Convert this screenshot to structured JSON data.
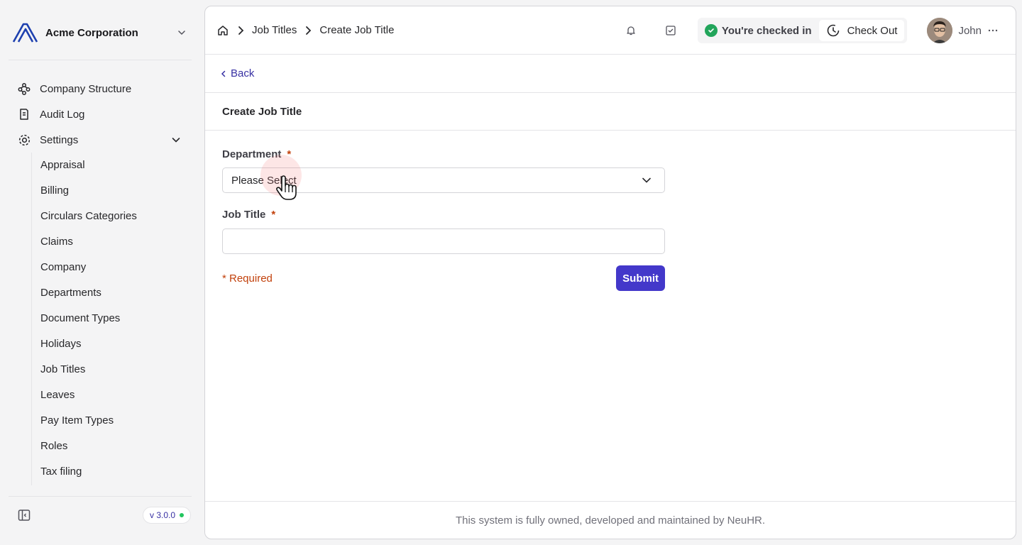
{
  "org": {
    "name": "Acme Corporation",
    "logo_icon": "acme-logo",
    "brand_color": "#1e40af"
  },
  "sidebar": {
    "items": [
      {
        "label": "Company Structure",
        "icon": "org-chart-icon"
      },
      {
        "label": "Audit Log",
        "icon": "document-icon"
      },
      {
        "label": "Settings",
        "icon": "gear-icon",
        "expanded": true
      }
    ],
    "settings_items": [
      "Appraisal",
      "Billing",
      "Circulars Categories",
      "Claims",
      "Company",
      "Departments",
      "Document Types",
      "Holidays",
      "Job Titles",
      "Leaves",
      "Pay Item Types",
      "Roles",
      "Tax filing"
    ],
    "version": "v 3.0.0"
  },
  "header": {
    "breadcrumbs": [
      "Job Titles",
      "Create Job Title"
    ],
    "checkin_status": "You're checked in",
    "checkout_label": "Check Out",
    "user_name": "John"
  },
  "page": {
    "back_label": "Back",
    "title": "Create Job Title"
  },
  "form": {
    "department_label": "Department",
    "department_value": "Please Select",
    "job_title_label": "Job Title",
    "job_title_value": "",
    "required_star": "*",
    "required_note": "* Required",
    "submit_label": "Submit"
  },
  "footer": {
    "text": "This system is fully owned, developed and maintained by NeuHR."
  },
  "colors": {
    "accent": "#4338ca",
    "link": "#3730a3",
    "required": "#c2410c",
    "success": "#22a55b"
  }
}
